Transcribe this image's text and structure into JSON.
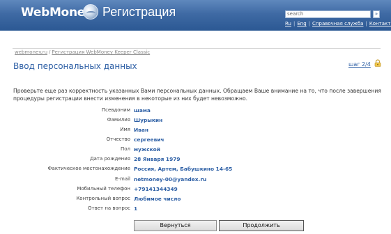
{
  "header": {
    "logo": "WebMoney",
    "title": "Регистрация",
    "search_placeholder": "search",
    "search_go": "»",
    "links": [
      "Ru",
      "Eng",
      "Справочная служба",
      "Контакты"
    ]
  },
  "breadcrumb": {
    "items": [
      "webmoney.ru",
      "Регистрация WebMoney Keeper Classic"
    ],
    "separator": "/"
  },
  "page": {
    "title": "Ввод персональных данных",
    "step": "шаг 2/4",
    "intro": "Проверьте еще раз корректность указанных Вами персональных данных. Обращаем Ваше внимание на то, что после завершения процедуры регистрации внести изменения в некоторые из них будет невозможно."
  },
  "fields": [
    {
      "label": "Псевдоним",
      "value": "шама"
    },
    {
      "label": "Фамилия",
      "value": "Шурыкин"
    },
    {
      "label": "Имя",
      "value": "Иван"
    },
    {
      "label": "Отчество",
      "value": "сергеевич"
    },
    {
      "label": "Пол",
      "value": "мужской"
    },
    {
      "label": "Дата рождения",
      "value": "28 Января 1979"
    },
    {
      "label": "Фактическое местонахождение",
      "value": "Россия, Артем, Бабушкино 14-65"
    },
    {
      "label": "E-mail",
      "value": "netmoney-00@yandex.ru"
    },
    {
      "label": "Мобильный телефон",
      "value": "+79141344349"
    },
    {
      "label": "Контрольный вопрос",
      "value": "Любимое число"
    },
    {
      "label": "Ответ на вопрос",
      "value": "1"
    }
  ],
  "buttons": {
    "back": "Вернуться",
    "next": "Продолжить"
  },
  "colors": {
    "header_top": "#5f88bd",
    "header_bottom": "#2b5893",
    "accent": "#2d5fa5"
  }
}
